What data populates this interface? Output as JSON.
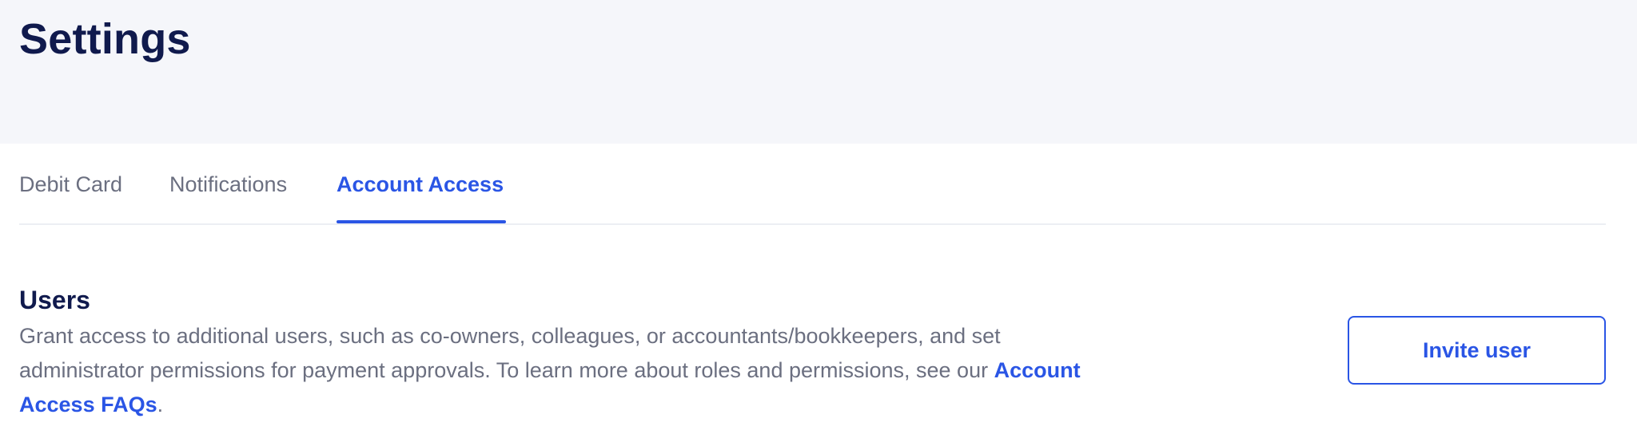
{
  "header": {
    "title": "Settings"
  },
  "tabs": [
    {
      "label": "Debit Card",
      "active": false
    },
    {
      "label": "Notifications",
      "active": false
    },
    {
      "label": "Account Access",
      "active": true
    }
  ],
  "users_section": {
    "title": "Users",
    "description_part1": "Grant access to additional users, such as co-owners, colleagues, or accountants/bookkeepers, and set administrator permissions for payment approvals. To learn more about roles and permissions, see our ",
    "faq_link_label": "Account Access FAQs",
    "description_end": ".",
    "invite_button_label": "Invite user"
  },
  "colors": {
    "accent": "#2a55e5",
    "heading": "#101a4d",
    "body_text": "#6b6f80",
    "header_background": "#f5f6fa"
  }
}
